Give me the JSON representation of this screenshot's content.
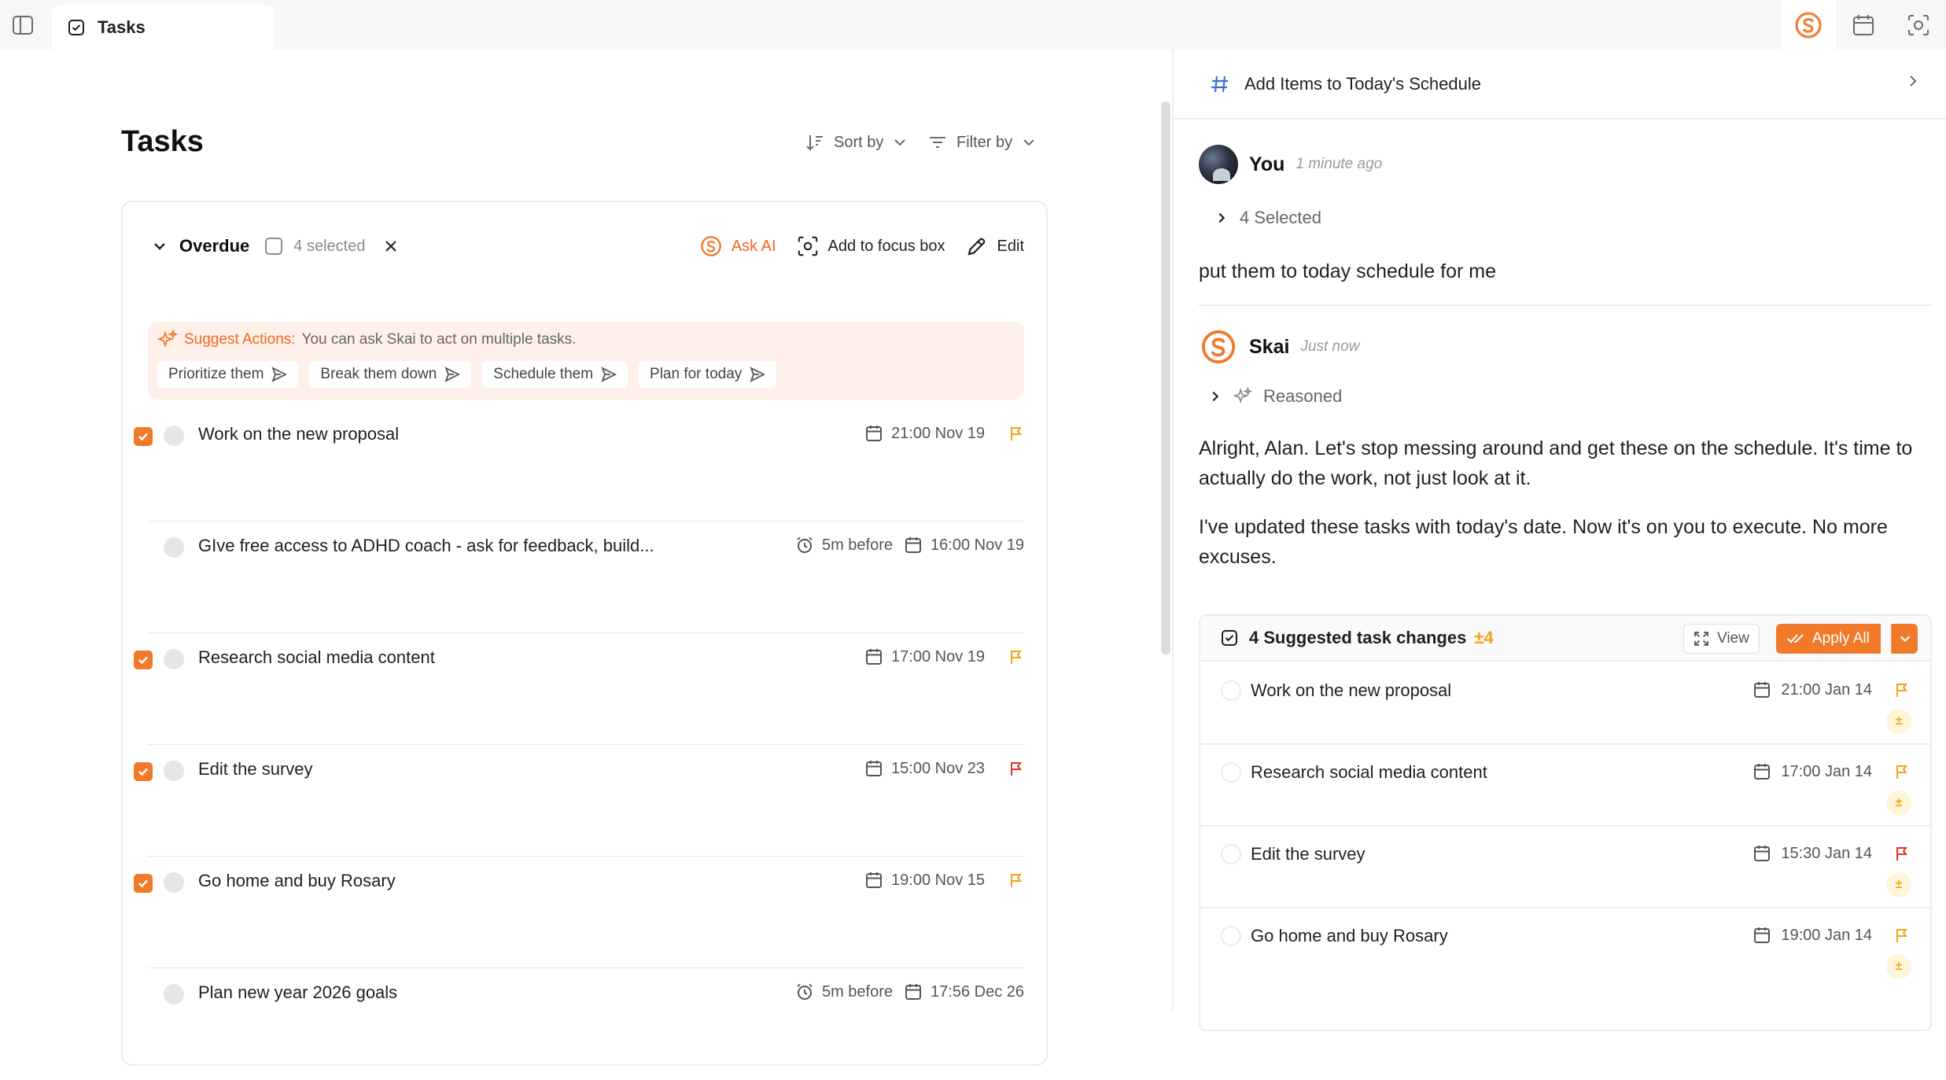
{
  "topbar": {
    "tab_label": "Tasks",
    "icons": [
      "sidebar-toggle-icon",
      "skai-logo-icon",
      "calendar-icon",
      "focus-icon"
    ]
  },
  "tasks_view": {
    "title": "Tasks",
    "sort_label": "Sort by",
    "filter_label": "Filter by",
    "group": {
      "name": "Overdue",
      "selected_text": "4 selected",
      "ask_ai_label": "Ask AI",
      "focus_label": "Add to focus box",
      "edit_label": "Edit",
      "suggest": {
        "label": "Suggest Actions:",
        "text": "You can ask Skai to act on multiple tasks.",
        "chips": [
          "Prioritize them",
          "Break them down",
          "Schedule them",
          "Plan for today"
        ]
      },
      "tasks": [
        {
          "title": "Work on the new proposal",
          "selected": true,
          "reminder": "",
          "due": "21:00 Nov 19",
          "flag": "#f2a31a"
        },
        {
          "title": "GIve free access to ADHD coach - ask for feedback, build...",
          "selected": false,
          "reminder": "5m before",
          "due": "16:00 Nov 19",
          "flag": ""
        },
        {
          "title": "Research social media content",
          "selected": true,
          "reminder": "",
          "due": "17:00 Nov 19",
          "flag": "#f2a31a"
        },
        {
          "title": "Edit the survey",
          "selected": true,
          "reminder": "",
          "due": "15:00 Nov 23",
          "flag": "#e0352b"
        },
        {
          "title": "Go home and buy Rosary",
          "selected": true,
          "reminder": "",
          "due": "19:00 Nov 15",
          "flag": "#f2a31a"
        },
        {
          "title": "Plan new year 2026 goals",
          "selected": false,
          "reminder": "5m before",
          "due": "17:56 Dec 26",
          "flag": ""
        }
      ]
    }
  },
  "chat": {
    "title": "Add Items to Today's Schedule",
    "user": {
      "name": "You",
      "time": "1 minute ago",
      "selected_label": "4 Selected",
      "message": "put them to today schedule for me"
    },
    "assistant": {
      "name": "Skai",
      "time": "Just now",
      "reasoned_label": "Reasoned",
      "paragraph1": "Alright, Alan. Let's stop messing around and get these on the schedule. It's time to actually do the work, not just look at it.",
      "paragraph2": "I've updated these tasks with today's date. Now it's on you to execute. No more excuses."
    },
    "changes": {
      "title": "4 Suggested task changes",
      "count": "±4",
      "view_label": "View",
      "apply_label": "Apply All",
      "items": [
        {
          "title": "Work on the new proposal",
          "due": "21:00 Jan 14",
          "flag": "#f2a31a"
        },
        {
          "title": "Research social media content",
          "due": "17:00 Jan 14",
          "flag": "#f2a31a"
        },
        {
          "title": "Edit the survey",
          "due": "15:30 Jan 14",
          "flag": "#e0352b"
        },
        {
          "title": "Go home and buy Rosary",
          "due": "19:00 Jan 14",
          "flag": "#f2a31a"
        }
      ]
    }
  },
  "colors": {
    "accent": "#f07a2a",
    "warning": "#f2a31a",
    "danger": "#e0352b"
  }
}
